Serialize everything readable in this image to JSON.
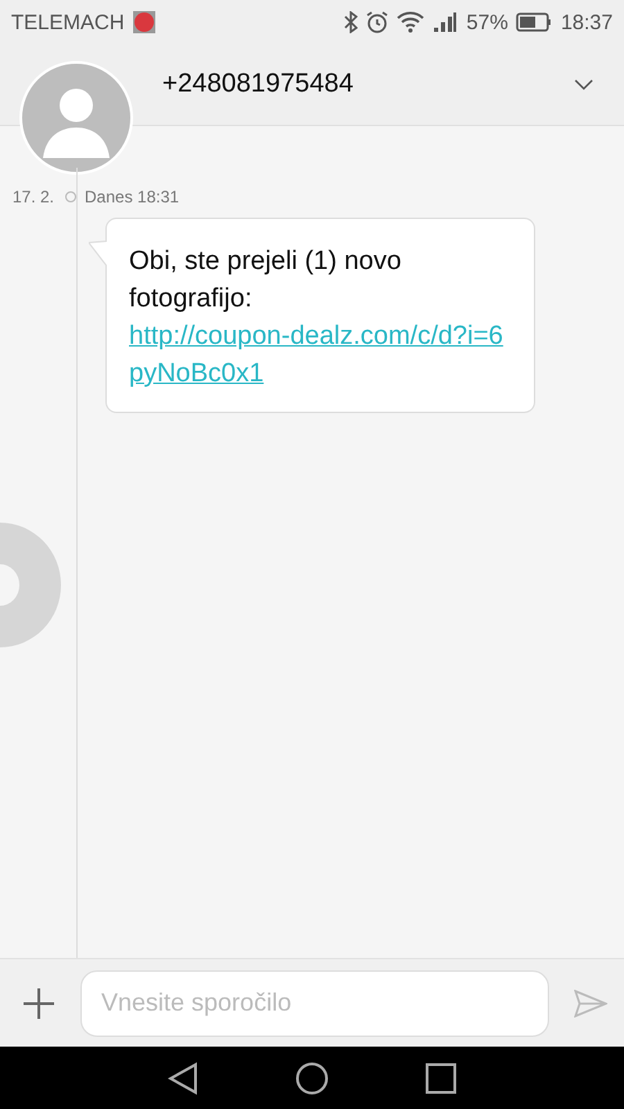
{
  "status_bar": {
    "carrier": "TELEMACH",
    "battery": "57%",
    "time": "18:37"
  },
  "header": {
    "contact": "+248081975484"
  },
  "messages": [
    {
      "date": "17. 2.",
      "time": "Danes 18:31",
      "text": "Obi, ste prejeli (1) novo fotografijo:",
      "link": "http://coupon-dealz.com/c/d?i=6pyNoBc0x1"
    }
  ],
  "composer": {
    "placeholder": "Vnesite sporočilo"
  }
}
